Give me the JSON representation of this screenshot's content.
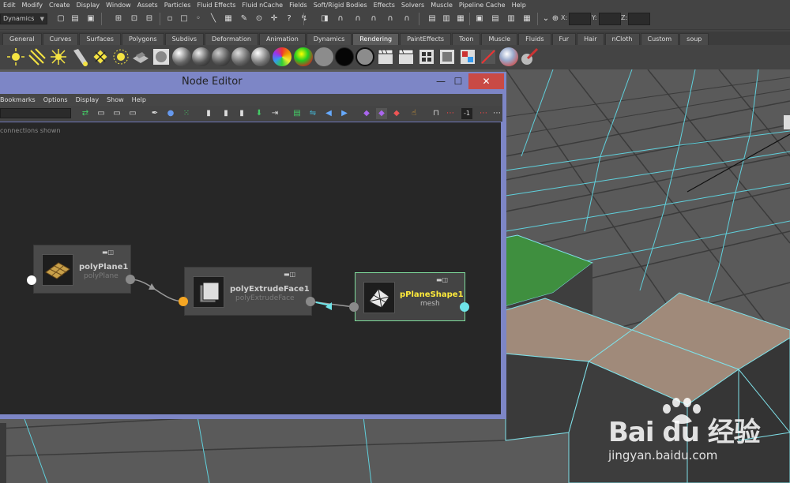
{
  "menubar": {
    "items": [
      "Edit",
      "Modify",
      "Create",
      "Display",
      "Window",
      "Assets",
      "Particles",
      "Fluid Effects",
      "Fluid nCache",
      "Fields",
      "Soft/Rigid Bodies",
      "Effects",
      "Solvers",
      "Muscle",
      "Pipeline Cache",
      "Help"
    ]
  },
  "statusline": {
    "mode": "Dynamics",
    "x_label": "X:",
    "y_label": "Y:",
    "z_label": "Z:"
  },
  "shelf_tabs": {
    "items": [
      "General",
      "Curves",
      "Surfaces",
      "Polygons",
      "Subdivs",
      "Deformation",
      "Animation",
      "Dynamics",
      "Rendering",
      "PaintEffects",
      "Toon",
      "Muscle",
      "Fluids",
      "Fur",
      "Hair",
      "nCloth",
      "Custom",
      "soup"
    ],
    "active": "Rendering"
  },
  "node_editor": {
    "title": "Node Editor",
    "menu": [
      "Bookmarks",
      "Options",
      "Display",
      "Show",
      "Help"
    ],
    "info": "connections shown",
    "toolbar_value": "-1",
    "nodes": [
      {
        "name": "polyPlane1",
        "type": "polyPlane"
      },
      {
        "name": "polyExtrudeFace1",
        "type": "polyExtrudeFace"
      },
      {
        "name": "pPlaneShape1",
        "type": "mesh"
      }
    ]
  },
  "window_controls": {
    "minimize": "—",
    "maximize": "☐",
    "close": "✕"
  },
  "watermark": {
    "logo": "Bai du 经验",
    "url": "jingyan.baidu.com"
  },
  "colors": {
    "accent_selected": "#7fdc9c",
    "titlebar": "#7d86c6",
    "close": "#c94a45",
    "port_in_orange": "#f5a623",
    "port_out_cyan": "#6fe4e8",
    "green_face": "#3f8f3f",
    "extruded_top": "#a08a7a"
  }
}
